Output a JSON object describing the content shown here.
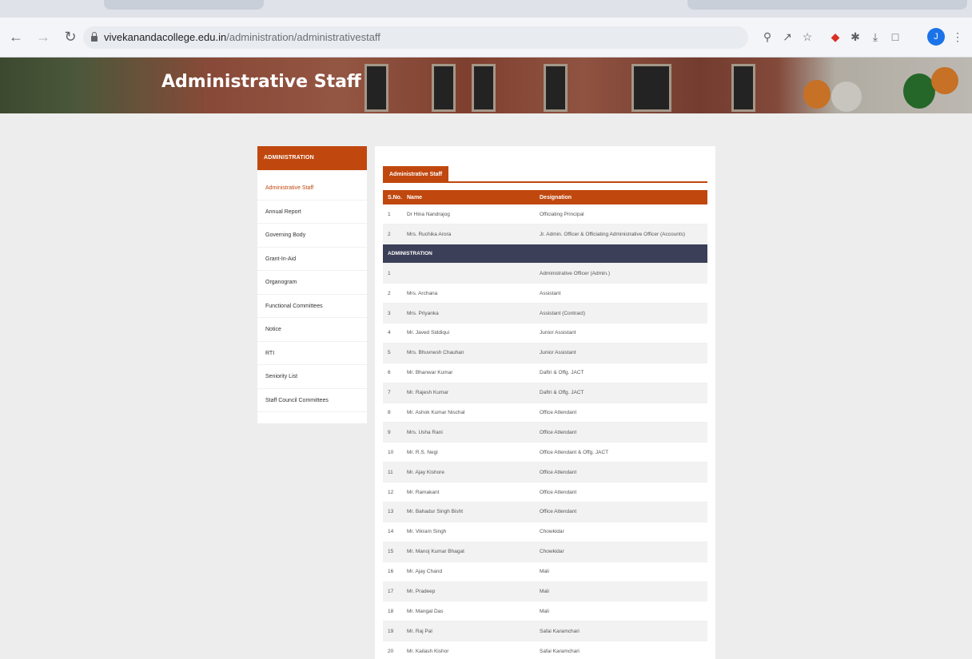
{
  "browser": {
    "url_domain": "vivekanandacollege.edu.in",
    "url_path": "/administration/administrativestaff",
    "avatar_letter": "J"
  },
  "banner": {
    "title": "Administrative Staff"
  },
  "sidebar": {
    "heading": "ADMINISTRATION",
    "items": [
      "Administrative Staff",
      "Annual Report",
      "Governing Body",
      "Grant-In-Aid",
      "Organogram",
      "Functional Committees",
      "Notice",
      "RTI",
      "Seniority List",
      "Staff Council Committees"
    ]
  },
  "main": {
    "tab_label": "Administrative Staff",
    "columns": [
      "S.No.",
      "Name",
      "Designation"
    ],
    "top_rows": [
      {
        "sno": "1",
        "name": "Dr Hina Nandrajog",
        "designation": "Officiating Principal"
      },
      {
        "sno": "2",
        "name": "Mrs. Ruchika Arora",
        "designation": "Jr. Admin. Officer & Officiating Administrative Officer (Accounts)"
      }
    ],
    "section_label": "ADMINISTRATION",
    "rows": [
      {
        "sno": "1",
        "name": "",
        "designation": "Administrative Officer (Admin.)"
      },
      {
        "sno": "2",
        "name": "Mrs. Archana",
        "designation": "Assistant"
      },
      {
        "sno": "3",
        "name": "Mrs. Priyanka",
        "designation": "Assistant (Contract)"
      },
      {
        "sno": "4",
        "name": "Mr. Javed Siddiqui",
        "designation": "Junior Assistant"
      },
      {
        "sno": "5",
        "name": "Mrs. Bhuvnesh Chauhan",
        "designation": "Junior Assistant"
      },
      {
        "sno": "6",
        "name": "Mr. Bhanwar Kumar",
        "designation": "Daftri & Offg. JACT"
      },
      {
        "sno": "7",
        "name": "Mr. Rajesh Kumar",
        "designation": "Daftri & Offg. JACT"
      },
      {
        "sno": "8",
        "name": "Mr. Ashok Kumar Nischal",
        "designation": "Office Attendant"
      },
      {
        "sno": "9",
        "name": "Mrs. Usha Rani",
        "designation": "Office Attendant"
      },
      {
        "sno": "10",
        "name": "Mr. R.S. Negi",
        "designation": "Office Attendant & Offg. JACT"
      },
      {
        "sno": "11",
        "name": "Mr. Ajay Kishore",
        "designation": "Office Attendant"
      },
      {
        "sno": "12",
        "name": "Mr. Ramakant",
        "designation": "Office Attendant"
      },
      {
        "sno": "13",
        "name": "Mr. Bahadur Singh Bisht",
        "designation": "Office Attendant"
      },
      {
        "sno": "14",
        "name": "Mr. Vikram Singh",
        "designation": "Chowkidar"
      },
      {
        "sno": "15",
        "name": "Mr. Manoj Kumar Bhagat",
        "designation": "Chowkidar"
      },
      {
        "sno": "16",
        "name": "Mr. Ajay Chand",
        "designation": "Mali"
      },
      {
        "sno": "17",
        "name": "Mr. Pradeep",
        "designation": "Mali"
      },
      {
        "sno": "18",
        "name": "Mr. Mangal Das",
        "designation": "Mali"
      },
      {
        "sno": "19",
        "name": "Mr. Raj Pal",
        "designation": "Safai Karamchari"
      },
      {
        "sno": "20",
        "name": "Mr. Kailash Kishor",
        "designation": "Safai Karamchari"
      }
    ]
  }
}
